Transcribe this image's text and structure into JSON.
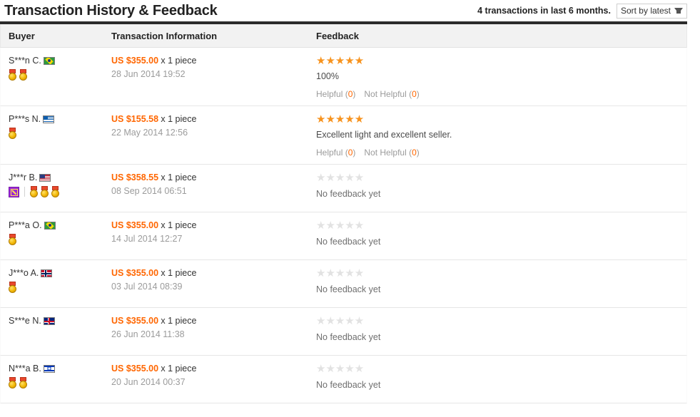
{
  "header": {
    "title": "Transaction History & Feedback",
    "transaction_count_text": "4 transactions in last 6 months.",
    "sort_label": "Sort by latest"
  },
  "columns": {
    "buyer": "Buyer",
    "transaction_information": "Transaction Information",
    "feedback": "Feedback"
  },
  "labels": {
    "helpful": "Helpful",
    "not_helpful": "Not Helpful",
    "no_feedback": "No feedback yet",
    "quantity": "x 1 piece"
  },
  "colors": {
    "accent_orange": "#ff6600",
    "star_on": "#f7931e",
    "star_off": "#e2e2e2",
    "header_bg": "#f2f2f2",
    "header_rule": "#2b2b2b",
    "badge_purple": "#9b27d6"
  },
  "rows": [
    {
      "buyer": "S***n C.",
      "flag": "br",
      "medals": 2,
      "verified_badge": false,
      "price": "US $355.00",
      "qty": "x 1 piece",
      "date": "28 Jun 2014 19:52",
      "stars": 5,
      "stars_glyphs": "★★★★★",
      "empty_glyphs": "★★★★★",
      "feedback_pct": "100%",
      "feedback_text": "",
      "has_feedback": true,
      "helpful_count": "0",
      "not_helpful_count": "0"
    },
    {
      "buyer": "P***s N.",
      "flag": "gr",
      "medals": 1,
      "verified_badge": false,
      "price": "US $155.58",
      "qty": "x 1 piece",
      "date": "22 May 2014 12:56",
      "stars": 5,
      "stars_glyphs": "★★★★★",
      "empty_glyphs": "★★★★★",
      "feedback_pct": "",
      "feedback_text": "Excellent light and excellent seller.",
      "has_feedback": true,
      "helpful_count": "0",
      "not_helpful_count": "0"
    },
    {
      "buyer": "J***r B.",
      "flag": "us",
      "medals": 3,
      "verified_badge": true,
      "price": "US $358.55",
      "qty": "x 1 piece",
      "date": "08 Sep 2014 06:51",
      "stars": 0,
      "stars_glyphs": "",
      "empty_glyphs": "★★★★★",
      "feedback_pct": "",
      "feedback_text": "",
      "has_feedback": false,
      "helpful_count": "",
      "not_helpful_count": ""
    },
    {
      "buyer": "P***a O.",
      "flag": "br",
      "medals": 1,
      "verified_badge": false,
      "price": "US $355.00",
      "qty": "x 1 piece",
      "date": "14 Jul 2014 12:27",
      "stars": 0,
      "stars_glyphs": "",
      "empty_glyphs": "★★★★★",
      "feedback_pct": "",
      "feedback_text": "",
      "has_feedback": false,
      "helpful_count": "",
      "not_helpful_count": ""
    },
    {
      "buyer": "J***o A.",
      "flag": "no",
      "medals": 1,
      "verified_badge": false,
      "price": "US $355.00",
      "qty": "x 1 piece",
      "date": "03 Jul 2014 08:39",
      "stars": 0,
      "stars_glyphs": "",
      "empty_glyphs": "★★★★★",
      "feedback_pct": "",
      "feedback_text": "",
      "has_feedback": false,
      "helpful_count": "",
      "not_helpful_count": ""
    },
    {
      "buyer": "S***e N.",
      "flag": "gb",
      "medals": 0,
      "verified_badge": false,
      "price": "US $355.00",
      "qty": "x 1 piece",
      "date": "26 Jun 2014 11:38",
      "stars": 0,
      "stars_glyphs": "",
      "empty_glyphs": "★★★★★",
      "feedback_pct": "",
      "feedback_text": "",
      "has_feedback": false,
      "helpful_count": "",
      "not_helpful_count": ""
    },
    {
      "buyer": "N***a B.",
      "flag": "il",
      "medals": 2,
      "verified_badge": false,
      "price": "US $355.00",
      "qty": "x 1 piece",
      "date": "20 Jun 2014 00:37",
      "stars": 0,
      "stars_glyphs": "",
      "empty_glyphs": "★★★★★",
      "feedback_pct": "",
      "feedback_text": "",
      "has_feedback": false,
      "helpful_count": "",
      "not_helpful_count": ""
    }
  ]
}
